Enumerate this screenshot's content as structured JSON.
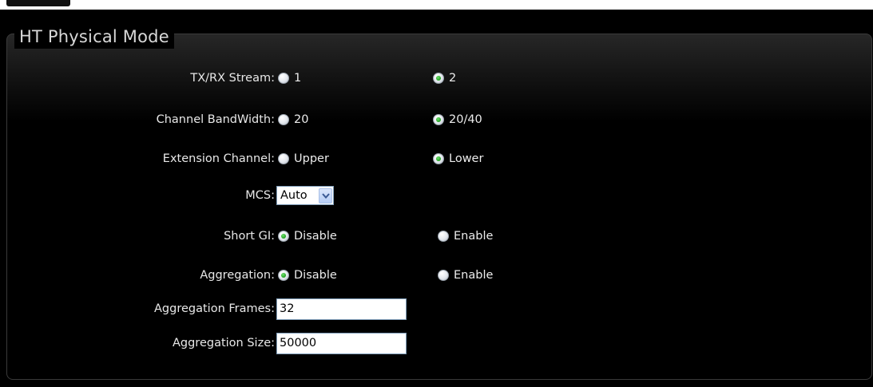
{
  "section": {
    "title": "HT Physical Mode"
  },
  "rows": {
    "txrx": {
      "label": "TX/RX Stream:",
      "options": [
        "1",
        "2"
      ],
      "selected": "2"
    },
    "bandwidth": {
      "label": "Channel BandWidth:",
      "options": [
        "20",
        "20/40"
      ],
      "selected": "20/40"
    },
    "extension": {
      "label": "Extension Channel:",
      "options": [
        "Upper",
        "Lower"
      ],
      "selected": "Lower"
    },
    "mcs": {
      "label": "MCS:",
      "value": "Auto"
    },
    "short_gi": {
      "label": "Short GI:",
      "options": [
        "Disable",
        "Enable"
      ],
      "selected": "Disable"
    },
    "aggregation": {
      "label": "Aggregation:",
      "options": [
        "Disable",
        "Enable"
      ],
      "selected": "Disable"
    },
    "agg_frames": {
      "label": "Aggregation Frames:",
      "value": "32"
    },
    "agg_size": {
      "label": "Aggregation Size:",
      "value": "50000"
    }
  },
  "colors": {
    "background": "#000000",
    "text": "#e8e8e8",
    "radio_selected": "#22a022",
    "input_border": "#7f9db9"
  }
}
